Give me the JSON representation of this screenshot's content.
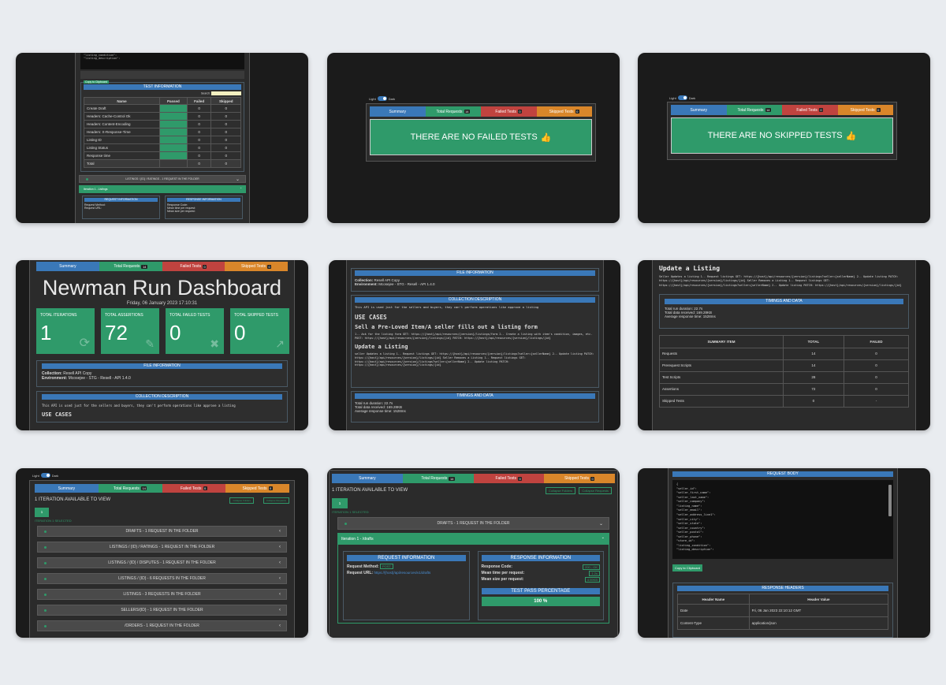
{
  "tabs": {
    "summary": "Summary",
    "total": "Total Requests",
    "failed": "Failed Tests",
    "skipped": "Skipped Tests",
    "total_count": "14",
    "failed_count": "0",
    "skipped_count": "0"
  },
  "toggle": {
    "light": "Light",
    "dark": "Dark"
  },
  "card1": {
    "code_lines": [
      "\"listing_condition\": ",
      "\"listing_description\":"
    ],
    "copy": "Copy to Clipboard",
    "test_info": "TEST INFORMATION",
    "search": "Search:",
    "headers": [
      "Name",
      "Passed",
      "Failed",
      "Skipped"
    ],
    "rows": [
      [
        "Create Draft",
        "",
        "0",
        "0"
      ],
      [
        "Headers: Cache-Control Ok",
        "",
        "0",
        "0"
      ],
      [
        "Headers: Content-Encoding",
        "",
        "0",
        "0"
      ],
      [
        "Headers: X-Response-Time",
        "",
        "0",
        "0"
      ],
      [
        "Listing ID",
        "",
        "0",
        "0"
      ],
      [
        "Listing Status",
        "",
        "0",
        "0"
      ],
      [
        "Response time",
        "",
        "0",
        "0"
      ]
    ],
    "total_row": [
      "Total",
      "",
      "0",
      "0"
    ],
    "accordion1": "LISTINGS / {ID} / RATINGS - 1 REQUEST IN THE FOLDER",
    "accordion2": "Iteration 1 - Listings",
    "req_info": "REQUEST INFORMATION",
    "resp_info": "RESPONSE INFORMATION",
    "req_items": [
      "Request Method:",
      "Request URL:"
    ],
    "resp_items": [
      "Response Code:",
      "Mean time per request:",
      "Mean size per request:"
    ]
  },
  "card2": {
    "message": "THERE ARE NO FAILED TESTS"
  },
  "card3": {
    "message": "THERE ARE NO SKIPPED TESTS"
  },
  "card4": {
    "title": "Newman Run Dashboard",
    "date": "Friday, 06 January 2023 17:10:31",
    "stats": [
      {
        "label": "TOTAL ITERATIONS",
        "value": "1"
      },
      {
        "label": "TOTAL ASSERTIONS",
        "value": "72"
      },
      {
        "label": "TOTAL FAILED TESTS",
        "value": "0"
      },
      {
        "label": "TOTAL SKIPPED TESTS",
        "value": "0"
      }
    ],
    "file_info": "FILE INFORMATION",
    "collection_label": "Collection:",
    "collection_val": "Resell API Copy",
    "env_label": "Environment:",
    "env_val": "Mcosejee - STG - Resell - API 1.4.0",
    "coll_desc": "COLLECTION DESCRIPTION",
    "desc": "This API is used just for the sellers and buyers, they can't perform operations like approve a listing",
    "use_cases": "USE CASES"
  },
  "card5": {
    "file_info": "FILE INFORMATION",
    "collection_label": "Collection:",
    "collection_val": "Resell API Copy",
    "env_label": "Environment:",
    "env_val": "Mcosejee - STG - Resell - API 1.4.0",
    "coll_desc": "COLLECTION DESCRIPTION",
    "desc": "This API is used just for the sellers and buyers, they can't perform operations like approve a listing",
    "use_cases": "USE CASES",
    "h_sell": "Sell a Pre-Loved Item/A seller fills out a listing form",
    "sell_text": "1.- Ask for the listing form GET: https://{host}/api/resources/{version}/listings/form 2.- Create a listing with item's condition, images, etc. POST: https://{host}/api/resources/{version}/listings/{id} PATCH: https://{host}/api/resources/{version}/listings/{id}",
    "h_update": "Update a Listing",
    "update_text": "seller Updates a listing 1.- Request listings GET: https://{host}/api/resources/{version}/listings?seller={sellerName} 2.- Update listing PATCH: https://{host}/api/resources/{version}/listings/{id} Seller Removes a Listing 1.- Request listings GET: https://{host}/api/resources/{version}/listings?seller={sellerName} 2.- Update listing PATCH: https://{host}/api/resources/{version}/listings/{id}",
    "timings": "TIMINGS AND DATA",
    "t1": "Total run duration: 22.7s",
    "t2": "Total data received: 169.28KB",
    "t3": "Average response time: 1528ms"
  },
  "card6": {
    "h_update": "Update a Listing",
    "update_text": "Seller Updates a listing 1.- Request listings GET: https://{host}/api/resources/{version}/listings?seller={sellerName} 2.- Update listing PATCH: https://{host}/api/resources/{version}/listings/{id} Seller Removes a Listing 1.- Request listings GET: https://{host}/api/resources/{version}/listings?seller={sellerName} 2.- Update listing PATCH: https://{host}/api/resources/{version}/listings/{id}",
    "timings": "TIMINGS AND DATA",
    "t1": "Total run duration: 22.7s",
    "t2": "Total data received: 169.28KB",
    "t3": "Average response time: 1528ms",
    "headers": [
      "SUMMARY ITEM",
      "TOTAL",
      "FAILED"
    ],
    "rows": [
      [
        "Requests",
        "14",
        "0"
      ],
      [
        "Prerequest Scripts",
        "14",
        "0"
      ],
      [
        "Test Scripts",
        "28",
        "0"
      ],
      [
        "Assertions",
        "72",
        "0"
      ],
      [
        "Skipped Tests",
        "0",
        "-"
      ]
    ]
  },
  "card7": {
    "iter_title": "1 ITERATION AVAILABLE TO VIEW",
    "collapse_folders": "Collapse Folders",
    "collapse_requests": "Collapse Requests",
    "iter_btn": "1",
    "iter_selected": "ITERATION 1 SELECTED",
    "folders": [
      "DRAFTS - 1 REQUEST IN THE FOLDER",
      "LISTINGS / {ID} / RATINGS - 1 REQUEST IN THE FOLDER",
      "LISTINGS / {ID} / DISPUTES - 1 REQUEST IN THE FOLDER",
      "LISTINGS / {ID} - 6 REQUESTS IN THE FOLDER",
      "LISTINGS - 3 REQUESTS IN THE FOLDER",
      "SELLERS/{ID} - 1 REQUEST IN THE FOLDER",
      "/ORDERS - 1 REQUEST IN THE FOLDER"
    ]
  },
  "card8": {
    "iter_title": "1 ITERATION AVAILABLE TO VIEW",
    "collapse_folders": "Collapse Folders",
    "collapse_requests": "Collapse Requests",
    "iter_btn": "1",
    "iter_selected": "ITERATION 1 SELECTED",
    "folder": "DRAFTS - 1 REQUEST IN THE FOLDER",
    "iteration": "Iteration 1 - /drafts",
    "req_info": "REQUEST INFORMATION",
    "resp_info": "RESPONSE INFORMATION",
    "req_method": "Request Method:",
    "method_val": "POST",
    "req_url": "Request URL:",
    "url_val": "https://{host}/api/resources/v1/drafts",
    "resp_code": "Response Code:",
    "code_val": "200 - OK",
    "mean_time": "Mean time per request:",
    "time_val": "1.2s",
    "mean_size": "Mean size per request:",
    "size_val": "4.59KB",
    "pass_pct": "TEST PASS PERCENTAGE",
    "pct_val": "100 %"
  },
  "card9": {
    "req_body": "REQUEST BODY",
    "body_lines": [
      "{",
      "  \"seller_id\": ",
      "  \"seller_first_name\": ",
      "  \"seller_last_name\": ",
      "  \"seller_company\": ",
      "  \"listing_name\": ",
      "  \"seller_email\": ",
      "  \"seller_address_line1\": ",
      "  \"seller_city\": ",
      "  \"seller_state\": ",
      "  \"seller_country\": ",
      "  \"seller_postal\": ",
      "  \"seller_phone\": ",
      "  \"store_id\": ",
      "  \"listing_condition\": ",
      "  \"listing_description\": "
    ],
    "copy": "Copy to Clipboard",
    "resp_headers": "RESPONSE HEADERS",
    "headers": [
      "Header Name",
      "Header Value"
    ],
    "rows": [
      [
        "Date",
        "Fri, 06 Jan 2023 22:10:12 GMT"
      ],
      [
        "Content-Type",
        "application/json"
      ]
    ]
  }
}
